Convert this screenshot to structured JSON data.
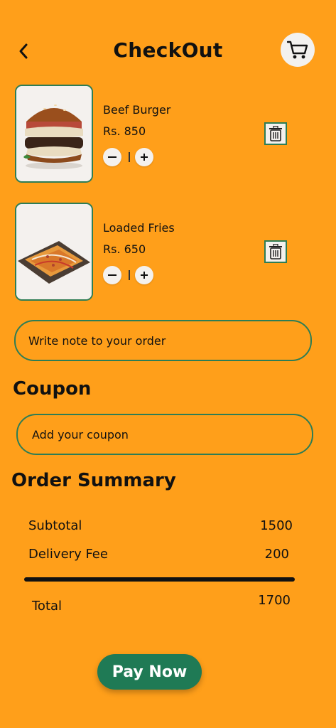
{
  "header": {
    "title": "CheckOut"
  },
  "items": [
    {
      "name": "Beef Burger",
      "price": "Rs. 850",
      "image": "beef-burger-photo"
    },
    {
      "name": "Loaded Fries",
      "price": "Rs. 650",
      "image": "loaded-fries-photo"
    }
  ],
  "note": {
    "placeholder": "Write note to your order"
  },
  "coupon": {
    "heading": "Coupon",
    "placeholder": "Add your coupon"
  },
  "summary": {
    "heading": "Order Summary",
    "rows": [
      {
        "label": "Subtotal",
        "value": "1500"
      },
      {
        "label": "Delivery Fee",
        "value": "200"
      }
    ],
    "total_label": "Total",
    "total_value": "1700"
  },
  "pay_button": {
    "label": "Pay Now"
  },
  "colors": {
    "background": "#FF9F1A",
    "accent": "#1F7A55",
    "border": "#2E7D55"
  }
}
